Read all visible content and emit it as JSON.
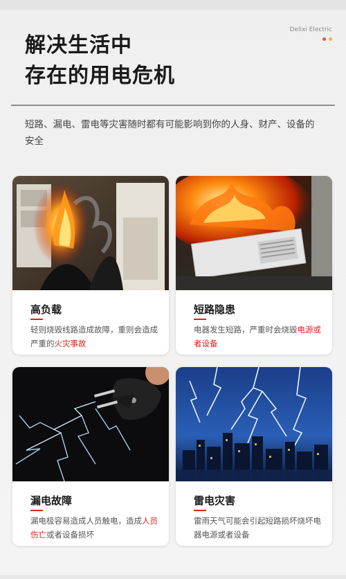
{
  "header": {
    "title_line1": "解决生活中",
    "title_line2": "存在的用电危机",
    "brand": "Delixi Electric",
    "brand_dot_colors": [
      "#f0504a",
      "#f6b13a"
    ]
  },
  "intro": {
    "text": "短路、漏电、雷电等灾害随时都有可能影响到你的人身、财产、设备的安全"
  },
  "cards": [
    {
      "title": "高负载",
      "desc_pre": "轻则烧毁线路造成故障，重则会造成严重的",
      "desc_highlight": "火灾事故",
      "desc_post": "",
      "image": "burning-outlet"
    },
    {
      "title": "短路隐患",
      "desc_pre": "电器发生短路，严重时会烧毁",
      "desc_highlight": "电源或者设备",
      "desc_post": "",
      "image": "burning-air-conditioner"
    },
    {
      "title": "漏电故障",
      "desc_pre": "漏电极容易造成人员触电，造成",
      "desc_highlight": "人员伤亡",
      "desc_post": "或者设备损坏",
      "image": "sparking-plug"
    },
    {
      "title": "雷电灾害",
      "desc_pre": "雷雨天气可能会引起短路损坏烧坏电器电源或者设备",
      "desc_highlight": "",
      "desc_post": "",
      "image": "lightning-city"
    }
  ],
  "colors": {
    "accent": "#e02020"
  }
}
